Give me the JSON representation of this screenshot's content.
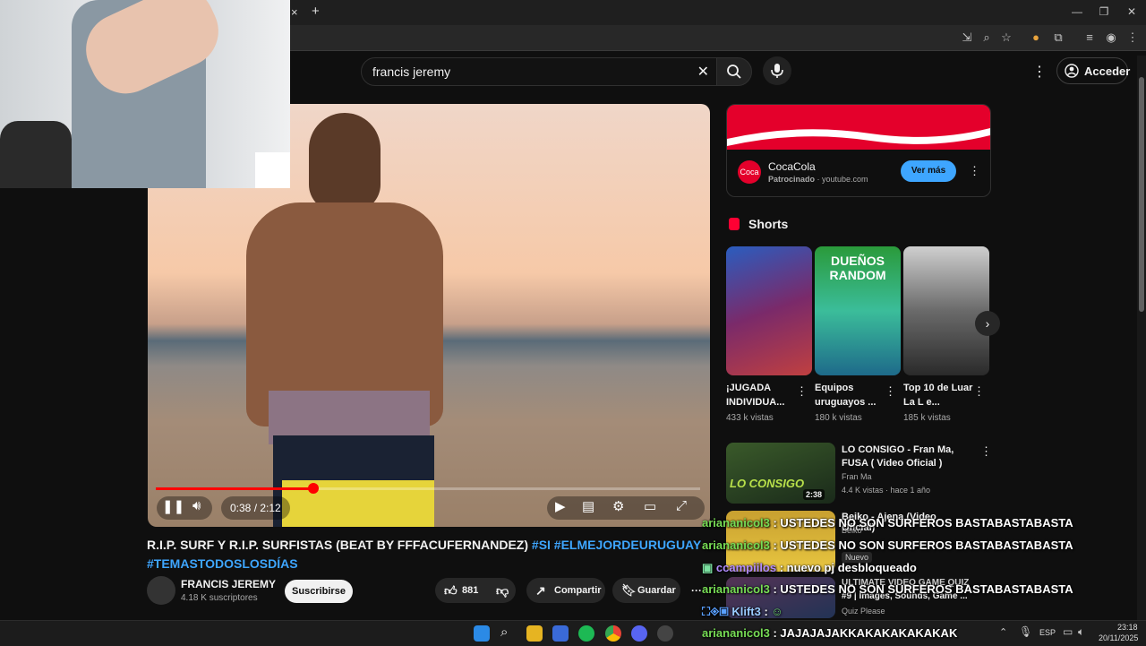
{
  "browser": {
    "new_tab_label": "+",
    "close_tab_label": "×"
  },
  "header": {
    "search_value": "francis jeremy",
    "signin_label": "Acceder"
  },
  "player": {
    "time": "0:38 / 2:12",
    "progress": 0.29
  },
  "video": {
    "title_plain": "R.I.P. SURF Y R.I.P. SURFISTAS (BEAT BY FFFACUFERNANDEZ) ",
    "title_tags_line1": "#SI #ELMEJORDEURUGUAY",
    "title_tags_line2": "#TEMASTODOSLOSDÍAS",
    "channel": "FRANCIS JEREMY",
    "subscribers": "4.18 K suscriptores",
    "subscribe_label": "Suscribirse",
    "likes": "881",
    "share_label": "Compartir",
    "save_label": "Guardar",
    "more_label": "···"
  },
  "ad": {
    "title": "CocaCola",
    "sponsored": "Patrocinado",
    "domain": "· youtube.com",
    "cta": "Ver más",
    "brand_color": "#e4002b"
  },
  "shorts": {
    "heading": "Shorts",
    "items": [
      {
        "title": "¡JUGADA INDIVIDUA...",
        "views": "433 k vistas"
      },
      {
        "title": "Equipos uruguayos ...",
        "views": "180 k vistas",
        "thumb_text": "DUEÑOS RANDOM"
      },
      {
        "title": "Top 10 de Luar La L e...",
        "views": "185 k vistas"
      }
    ]
  },
  "recommended": [
    {
      "title": "LO CONSIGO - Fran Ma, FUSA ( Video Oficial )",
      "channel": "Fran Ma",
      "meta": "4.4 K vistas · hace 1 año",
      "duration": "2:38",
      "thumb_text": "LO CONSIGO"
    },
    {
      "title": "Beiko - Ajena (Video Oficial)",
      "channel": "Beiko",
      "badge": "Nuevo"
    },
    {
      "title": "ULTIMATE VIDEO GAME QUIZ",
      "subtitle": "#9 | Images, Sounds, Game ...",
      "channel": "Quiz Please"
    }
  ],
  "chat": [
    {
      "user": "ariananicol3",
      "text": " : USTEDES NO SON SURFEROS BASTABASTABASTA"
    },
    {
      "user": "ariananicol3",
      "text": " : USTEDES NO SON SURFEROS BASTABASTABASTA"
    },
    {
      "user": "ccampiilos",
      "text": " : nuevo pj desbloqueado"
    },
    {
      "user": "ariananicol3",
      "text": " : USTEDES NO SON SURFEROS BASTABASTABASTA"
    },
    {
      "user": "Klift3",
      "text": " : "
    },
    {
      "user": "ariananicol3",
      "text": " : JAJAJAJAKKAKAKAKAKAKAK"
    }
  ],
  "taskbar": {
    "lang": "ESP",
    "time": "23:18",
    "date": "20/11/2025"
  }
}
